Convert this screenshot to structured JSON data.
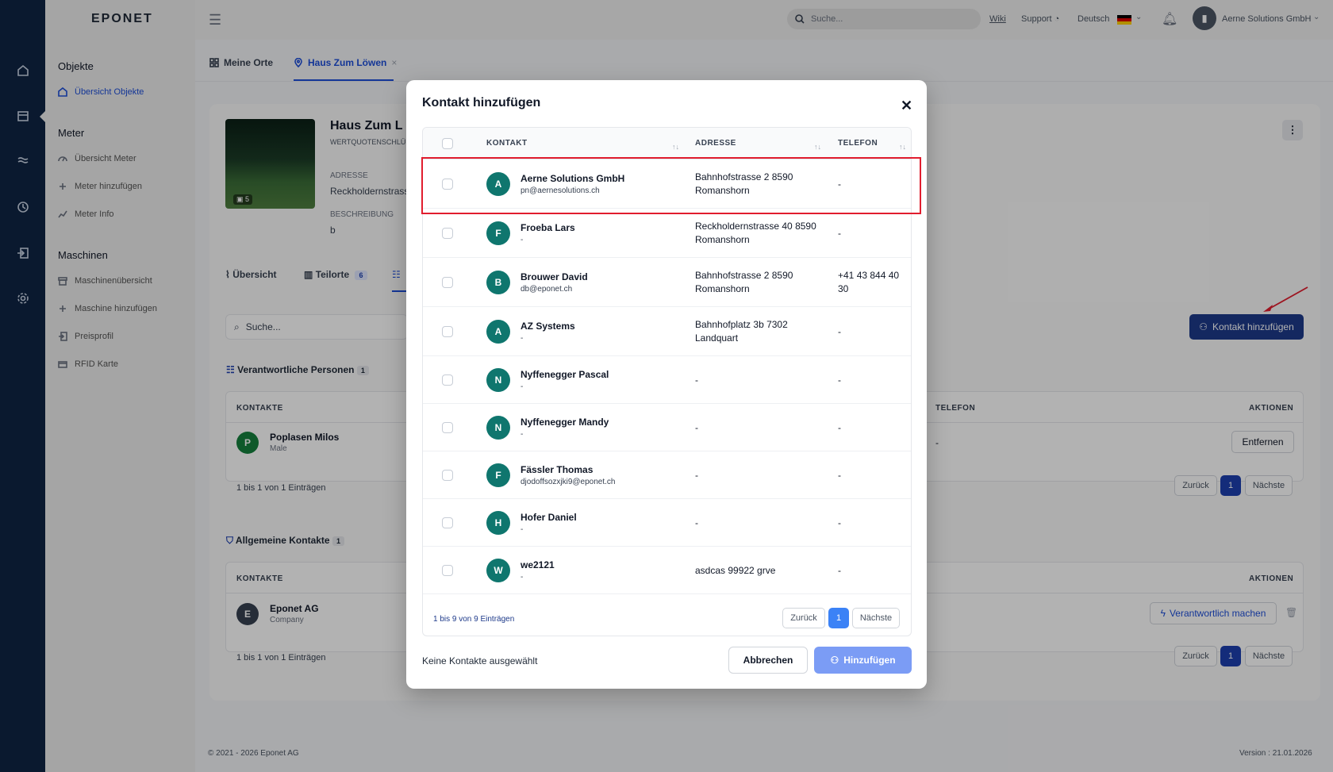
{
  "app": {
    "logo": "EPONET"
  },
  "header": {
    "search_placeholder": "Suche...",
    "wiki": "Wiki",
    "support": "Support",
    "language": "Deutsch",
    "company": "Aerne Solutions GmbH"
  },
  "sidebar": {
    "sections": [
      {
        "title": "Objekte",
        "items": [
          "Übersicht Objekte"
        ]
      },
      {
        "title": "Meter",
        "items": [
          "Übersicht Meter",
          "Meter hinzufügen",
          "Meter Info"
        ]
      },
      {
        "title": "Maschinen",
        "items": [
          "Maschinenübersicht",
          "Maschine hinzufügen",
          "Preisprofil",
          "RFID Karte"
        ]
      }
    ]
  },
  "page_tabs": [
    "Meine Orte",
    "Haus Zum Löwen"
  ],
  "object": {
    "name": "Haus Zum L",
    "subtitle": "WERTQUOTENSCHLÜ",
    "address_label": "ADRESSE",
    "address_value": "Reckholdernstrass",
    "description_label": "BESCHREIBUNG",
    "description_value": "b",
    "photo_count": "5"
  },
  "detail_tabs": [
    {
      "label": "Übersicht"
    },
    {
      "label": "Teilorte",
      "count": "6"
    }
  ],
  "content": {
    "search_placeholder": "Suche...",
    "add_contact_button": "Kontakt hinzufügen",
    "responsible": {
      "title": "Verantwortliche Personen",
      "count": "1",
      "col_contacts": "KONTAKTE",
      "col_phone": "TELEFON",
      "col_actions": "AKTIONEN",
      "row": {
        "initial": "P",
        "name": "Poplasen Milos",
        "sub": "Male",
        "phone": "-",
        "action": "Entfernen"
      },
      "footer": "1 bis 1 von 1 Einträgen",
      "prev": "Zurück",
      "page": "1",
      "next": "Nächste"
    },
    "general": {
      "title": "Allgemeine Kontakte",
      "count": "1",
      "col_contacts": "KONTAKTE",
      "col_actions": "AKTIONEN",
      "row": {
        "initial": "E",
        "name": "Eponet AG",
        "sub": "Company",
        "action": "Verantwortlich machen"
      },
      "footer": "1 bis 1 von 1 Einträgen",
      "prev": "Zurück",
      "page": "1",
      "next": "Nächste"
    }
  },
  "footer": {
    "copyright": "© 2021 - 2026 Eponet AG",
    "version": "Version : 21.01.2026"
  },
  "modal": {
    "title": "Kontakt hinzufügen",
    "columns": {
      "contact": "KONTAKT",
      "address": "ADRESSE",
      "phone": "TELEFON"
    },
    "rows": [
      {
        "initial": "A",
        "name": "Aerne Solutions GmbH",
        "email": "pn@aernesolutions.ch",
        "address": [
          "Bahnhofstrasse 2 8590",
          "Romanshorn"
        ],
        "phone": [
          "-"
        ]
      },
      {
        "initial": "F",
        "name": "Froeba Lars",
        "email": "-",
        "address": [
          "Reckholdernstrasse 40 8590",
          "Romanshorn"
        ],
        "phone": [
          "-"
        ]
      },
      {
        "initial": "B",
        "name": "Brouwer David",
        "email": "db@eponet.ch",
        "address": [
          "Bahnhofstrasse 2 8590",
          "Romanshorn"
        ],
        "phone": [
          "+41 43 844 40",
          "30"
        ]
      },
      {
        "initial": "A",
        "name": "AZ Systems",
        "email": "-",
        "address": [
          "Bahnhofplatz 3b 7302",
          "Landquart"
        ],
        "phone": [
          "-"
        ]
      },
      {
        "initial": "N",
        "name": "Nyffenegger Pascal",
        "email": "-",
        "address": [
          "-"
        ],
        "phone": [
          "-"
        ]
      },
      {
        "initial": "N",
        "name": "Nyffenegger Mandy",
        "email": "-",
        "address": [
          "-"
        ],
        "phone": [
          "-"
        ]
      },
      {
        "initial": "F",
        "name": "Fässler Thomas",
        "email": "djodoffsozxjki9@eponet.ch",
        "address": [
          "-"
        ],
        "phone": [
          "-"
        ]
      },
      {
        "initial": "H",
        "name": "Hofer Daniel",
        "email": "-",
        "address": [
          "-"
        ],
        "phone": [
          "-"
        ]
      },
      {
        "initial": "W",
        "name": "we2121",
        "email": "-",
        "address": [
          "asdcas 99922 grve"
        ],
        "phone": [
          "-"
        ]
      }
    ],
    "table_footer": "1 bis 9 von 9 Einträgen",
    "prev": "Zurück",
    "page": "1",
    "next": "Nächste",
    "selection_status": "Keine Kontakte ausgewählt",
    "cancel": "Abbrechen",
    "submit": "Hinzufügen"
  },
  "colors": {
    "accent": "#1e3a8a",
    "avatar": "#0f766e",
    "highlight": "#e11d2e",
    "submit": "#7b9cf5"
  }
}
